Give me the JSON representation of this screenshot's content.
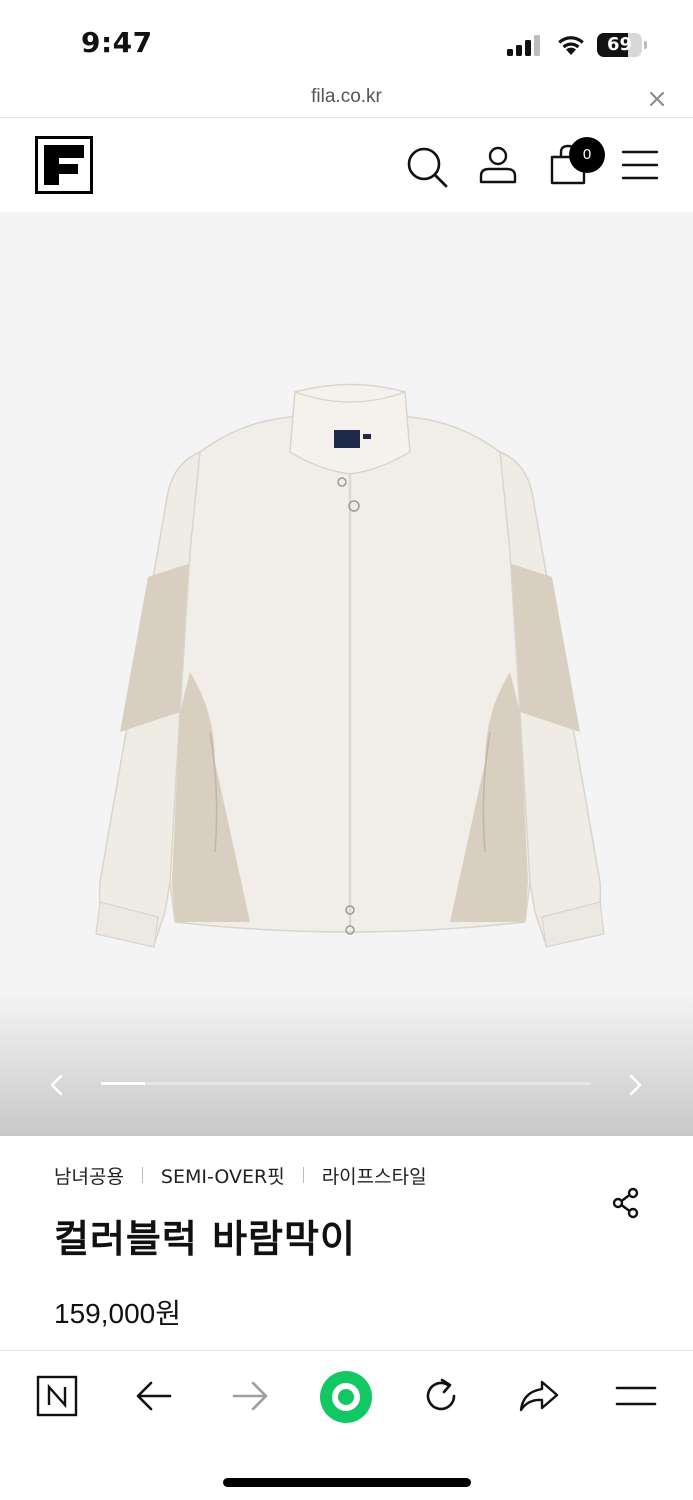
{
  "status_bar": {
    "time": "9:47",
    "battery": "69",
    "battery_level": 0.69
  },
  "browser": {
    "url": "fila.co.kr",
    "close_icon": "close-icon"
  },
  "header": {
    "logo_icon": "fila-logo",
    "icons": [
      "search-icon",
      "user-icon",
      "shopping-bag-icon",
      "menu-icon"
    ],
    "cart_count": "0"
  },
  "gallery": {
    "image_subject": "colorblock-windbreaker-jacket-photo",
    "current_progress": 0.09,
    "prev_icon": "chevron-left-icon",
    "next_icon": "chevron-right-icon"
  },
  "product": {
    "tags": [
      "남녀공용",
      "SEMI-OVER핏",
      "라이프스타일"
    ],
    "name": "컬러블럭 바람막이",
    "price": "159,000원",
    "share_icon": "share-icon"
  },
  "toolbar": {
    "icons": [
      "naver-n-icon",
      "back-arrow-icon",
      "forward-arrow-icon",
      "green-dot-icon",
      "reload-icon",
      "share-arrow-icon",
      "menu-icon"
    ]
  },
  "colors": {
    "accent_green": "#12c864",
    "background_gallery": "#f4f4f4",
    "text": "#111111"
  }
}
